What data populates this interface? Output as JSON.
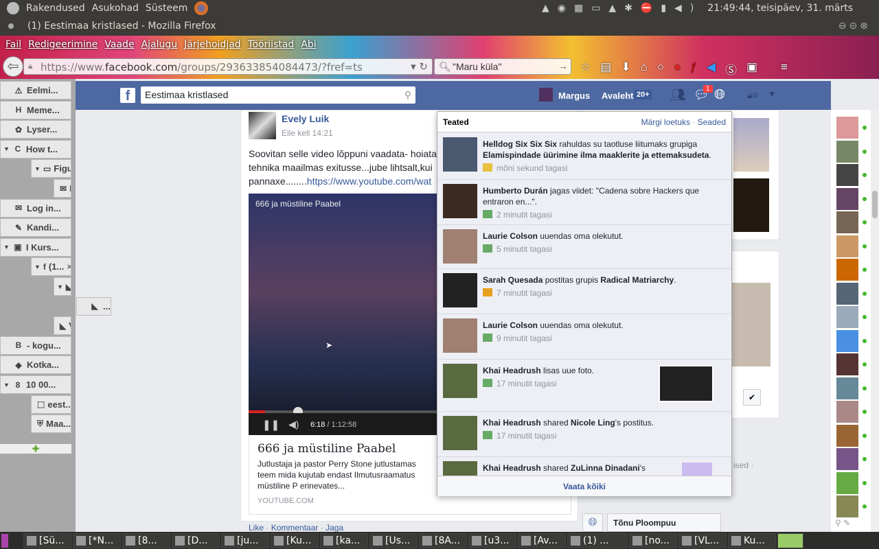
{
  "panel": {
    "menus": [
      "Rakendused",
      "Asukohad",
      "Süsteem"
    ],
    "clock": "21:49:44, teisipäev, 31. märts"
  },
  "window": {
    "title": "(1) Eestimaa kristlased - Mozilla Firefox"
  },
  "menubar": [
    "Fail",
    "Redigeerimine",
    "Vaade",
    "Ajalugu",
    "Järjehoidjad",
    "Tööriistad",
    "Abi"
  ],
  "urlbar": {
    "prefix": "https://www.",
    "domain": "facebook.com",
    "path": "/groups/293633854084473/?fref=ts"
  },
  "searchbar": {
    "value": "\"Maru küla\""
  },
  "sidebar_tabs": [
    {
      "label": "Eelmi...",
      "icon": "⚠",
      "indent": 0,
      "twisty": false
    },
    {
      "label": "Meme...",
      "icon": "H",
      "indent": 0,
      "twisty": false
    },
    {
      "label": "Lyser...",
      "icon": "✿",
      "indent": 0,
      "twisty": false
    },
    {
      "label": "How t...",
      "icon": "C",
      "indent": 0,
      "twisty": true
    },
    {
      "label": "Figu...",
      "icon": "▭",
      "indent": 1,
      "twisty": true
    },
    {
      "label": "Lo...",
      "icon": "✉",
      "indent": 2,
      "twisty": false
    },
    {
      "label": "Log in...",
      "icon": "✉",
      "indent": 0,
      "twisty": false
    },
    {
      "label": "Kandi...",
      "icon": "✎",
      "indent": 0,
      "twisty": false
    },
    {
      "label": "I Kurs...",
      "icon": "▣",
      "indent": 0,
      "twisty": true
    },
    {
      "label": "(1...",
      "icon": "f",
      "indent": 1,
      "twisty": true,
      "close": "×"
    },
    {
      "label": "VA...",
      "icon": "◣",
      "indent": 2,
      "twisty": true
    },
    {
      "label": "...",
      "icon": "◣",
      "indent": 3,
      "twisty": false
    },
    {
      "label": "VA...",
      "icon": "◣",
      "indent": 2,
      "twisty": false
    },
    {
      "label": "- kogu...",
      "icon": "B",
      "indent": 0,
      "twisty": false
    },
    {
      "label": "Kotka...",
      "icon": "◆",
      "indent": 0,
      "twisty": false
    },
    {
      "label": "10 00...",
      "icon": "8",
      "indent": 0,
      "twisty": true
    },
    {
      "label": "eest...",
      "icon": "⬚",
      "indent": 1,
      "twisty": false
    },
    {
      "label": "Maa...",
      "icon": "⛨",
      "indent": 1,
      "twisty": false
    }
  ],
  "fb": {
    "search_value": "Eestimaa kristlased",
    "user": "Margus",
    "home": "Avaleht",
    "home_badge": "20+",
    "messages_badge": "1",
    "post": {
      "author": "Evely Luik",
      "time": "Eile kell 14:21",
      "text_lines": [
        "Soovitan selle video lõppuni vaadata- hoiata",
        "tehnika maailmas exitusse...jube lihtsalt,kui",
        "pannaxe........"
      ],
      "link": "https://www.youtube.com/wat",
      "video_title": "666 ja müstiline Paabel",
      "video_time": "6:18",
      "video_duration": "/ 1:12:58",
      "video_progress": 0.084,
      "card_title": "666 ja müstiline Paabel",
      "card_desc": "Jutlustaja ja pastor Perry Stone jutlustamas teem mida kujutab endast Ilmutusraamatus müstiline P erinevates...",
      "card_source": "YOUTUBE.COM",
      "actions": [
        "Like",
        "Kommentaar",
        "Jaga"
      ]
    },
    "notifications": {
      "title": "Teated",
      "mark_read": "Märgi loetuks",
      "settings": "Seaded",
      "see_all": "Vaata kõiki",
      "items": [
        {
          "actor": "Helldog Six Six Six",
          "text": " rahuldas su taotluse liitumaks grupiga ",
          "obj": "Elamispindade üürimine ilma maaklerite ja ettemaksudeta",
          "end": ".",
          "time": "mõni sekund tagasi"
        },
        {
          "actor": "Humberto Durán",
          "text": " jagas viidet: \"Cadena sobre Hackers que entraron en...\".",
          "obj": "",
          "end": "",
          "time": "2 minutit tagasi"
        },
        {
          "actor": "Laurie Colson",
          "text": " uuendas oma olekutut.",
          "obj": "",
          "end": "",
          "time": "5 minutit tagasi"
        },
        {
          "actor": "Sarah Quesada",
          "text": " postitas grupis ",
          "obj": "Radical Matriarchy",
          "end": ".",
          "time": "7 minutit tagasi"
        },
        {
          "actor": "Laurie Colson",
          "text": " uuendas oma olekutut.",
          "obj": "",
          "end": "",
          "time": "9 minutit tagasi"
        },
        {
          "actor": "Khai Headrush",
          "text": " lisas uue foto.",
          "obj": "",
          "end": "",
          "time": "17 minutit tagasi"
        },
        {
          "actor": "Khai Headrush",
          "text": " shared ",
          "obj": "Nicole Ling",
          "end": "'s postitus.",
          "time": "17 minutit tagasi"
        },
        {
          "actor": "Khai Headrush",
          "text": " shared ",
          "obj": "ZuLinna Dinadani",
          "end": "'s",
          "time": ""
        }
      ]
    },
    "right_partial": "ised ·",
    "chat_tab": "Tõnu Ploompuu"
  },
  "taskbar": [
    "[Sü...",
    "[*N...",
    "[8...",
    "[D...",
    "[ju...",
    "[Ku...",
    "[ka...",
    "[Us...",
    "[8A...",
    "[u3...",
    "[Av...",
    "(1) ...",
    "[no...",
    "[VL...",
    "Ku..."
  ]
}
